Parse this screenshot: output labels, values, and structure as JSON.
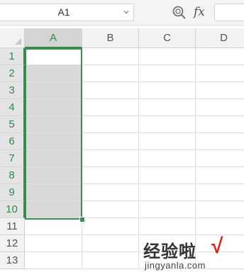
{
  "formula_bar": {
    "name_box": "A1",
    "zoom_icon": "magnify-icon",
    "fx_label": "fx",
    "formula_value": ""
  },
  "columns": [
    "A",
    "B",
    "C",
    "D"
  ],
  "rows": [
    "1",
    "2",
    "3",
    "4",
    "5",
    "6",
    "7",
    "8",
    "9",
    "10",
    "11",
    "12",
    "13"
  ],
  "selection": {
    "active_cell": "A1",
    "range": "A1:A10"
  },
  "colors": {
    "accent": "#3a8f4e",
    "selection_fill": "#d9d9d9",
    "header_bg": "#f2f2f2"
  },
  "watermark": {
    "title": "经验啦",
    "check": "√",
    "url": "jingyanla.com"
  }
}
